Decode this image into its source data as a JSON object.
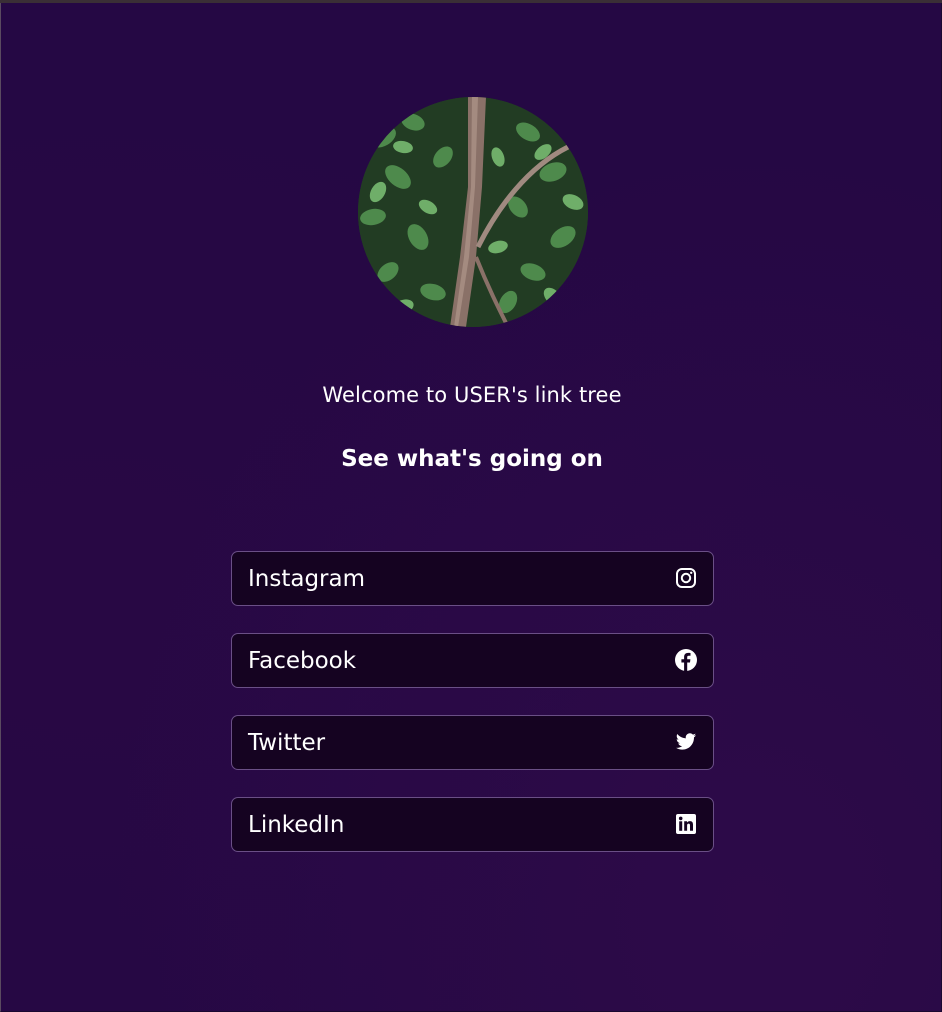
{
  "profile": {
    "welcome_text": "Welcome to USER's link tree",
    "subtitle": "See what's going on",
    "avatar_icon": "avatar-photo-vine-tree"
  },
  "links": [
    {
      "label": "Instagram",
      "icon": "instagram-icon"
    },
    {
      "label": "Facebook",
      "icon": "facebook-icon"
    },
    {
      "label": "Twitter",
      "icon": "twitter-icon"
    },
    {
      "label": "LinkedIn",
      "icon": "linkedin-icon"
    }
  ],
  "colors": {
    "background": "#250844",
    "button_background": "#150321",
    "button_border": "#6a4f86",
    "text": "#ffffff"
  }
}
